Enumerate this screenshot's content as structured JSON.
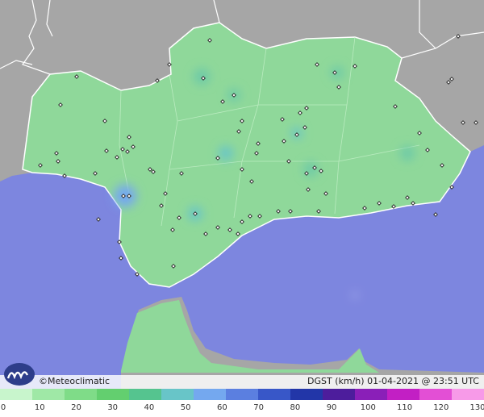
{
  "map": {
    "credit": "©Meteoclimatic",
    "caption": "DGST (km/h)  01-04-2021 @ 23:51 UTC",
    "colors": {
      "sea": "#7d86df",
      "land_outside": "#a6a6a6",
      "land_main": "#8fd89a",
      "border": "#ffffff",
      "station": "#222222"
    }
  },
  "legend": {
    "ticks": [
      "0",
      "10",
      "20",
      "30",
      "40",
      "50",
      "60",
      "70",
      "80",
      "90",
      "100",
      "110",
      "120",
      "130"
    ],
    "colors": [
      "#c8f5cc",
      "#9fe8a6",
      "#7fdc88",
      "#63cf6f",
      "#55c48f",
      "#68c5c8",
      "#74a8ef",
      "#5b7fe0",
      "#3857c8",
      "#2236a8",
      "#4d1d9c",
      "#8a1fb8",
      "#c21fc4",
      "#e34fd5",
      "#f79ae8"
    ]
  }
}
